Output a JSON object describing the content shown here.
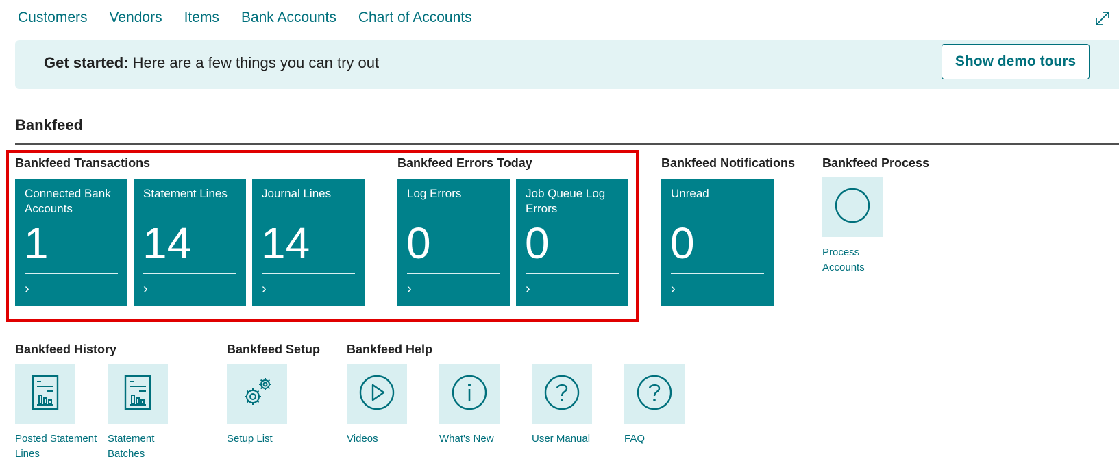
{
  "nav": {
    "items": [
      "Customers",
      "Vendors",
      "Items",
      "Bank Accounts",
      "Chart of Accounts"
    ],
    "expand_icon": "expand-icon"
  },
  "banner": {
    "bold": "Get started:",
    "text": " Here are a few things you can try out",
    "button": "Show demo tours"
  },
  "section": {
    "title": "Bankfeed"
  },
  "groups": {
    "transactions": {
      "title": "Bankfeed Transactions",
      "tiles": [
        {
          "label": "Connected Bank Accounts",
          "value": "1"
        },
        {
          "label": "Statement Lines",
          "value": "14"
        },
        {
          "label": "Journal Lines",
          "value": "14"
        }
      ]
    },
    "errors": {
      "title": "Bankfeed Errors Today",
      "tiles": [
        {
          "label": "Log Errors",
          "value": "0"
        },
        {
          "label": "Job Queue Log Errors",
          "value": "0"
        }
      ]
    },
    "notifications": {
      "title": "Bankfeed Notifications",
      "tiles": [
        {
          "label": "Unread",
          "value": "0"
        }
      ]
    },
    "process": {
      "title": "Bankfeed Process",
      "actions": [
        {
          "label": "Process Accounts",
          "icon": "circle-icon"
        }
      ]
    },
    "history": {
      "title": "Bankfeed History",
      "actions": [
        {
          "label": "Posted Statement Lines",
          "icon": "report-icon"
        },
        {
          "label": "Statement Batches",
          "icon": "report-icon"
        }
      ]
    },
    "setup": {
      "title": "Bankfeed Setup",
      "actions": [
        {
          "label": "Setup List",
          "icon": "gears-icon"
        }
      ]
    },
    "help": {
      "title": "Bankfeed Help",
      "actions": [
        {
          "label": "Videos",
          "icon": "play-icon"
        },
        {
          "label": "What's New",
          "icon": "info-icon"
        },
        {
          "label": "User Manual",
          "icon": "question-icon"
        },
        {
          "label": "FAQ",
          "icon": "question-icon"
        }
      ]
    }
  },
  "colors": {
    "accent": "#00707c",
    "tile": "#00818b",
    "banner": "#e3f3f4",
    "action_tile": "#d9eff1",
    "highlight": "#e00000"
  }
}
